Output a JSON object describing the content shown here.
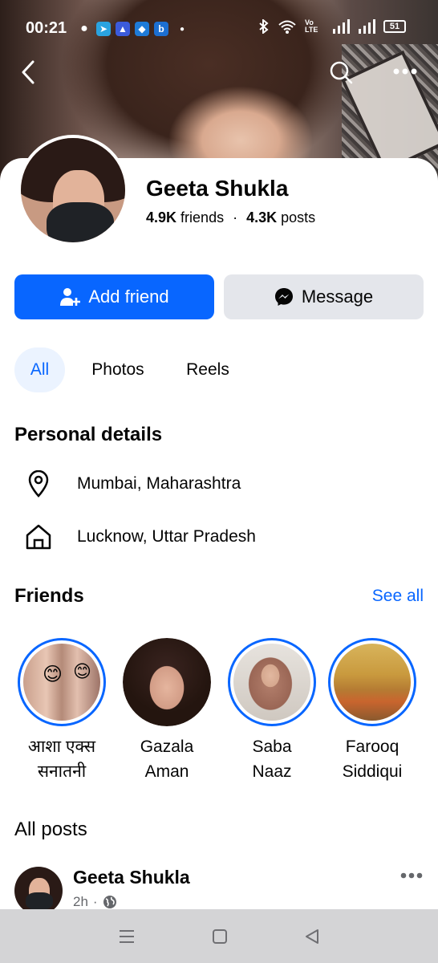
{
  "status_bar": {
    "time": "00:21",
    "notification_icons": [
      "chat-bubble-icon",
      "telegram-icon",
      "triangle-app-icon",
      "app-icon",
      "b-app-icon",
      "dot-icon"
    ],
    "network_label": "Vo LTE",
    "battery": "51"
  },
  "profile": {
    "name": "Geeta Shukla",
    "friends_count": "4.9K",
    "friends_label": "friends",
    "separator": "·",
    "posts_count": "4.3K",
    "posts_label": "posts"
  },
  "actions": {
    "add_friend": "Add friend",
    "message": "Message"
  },
  "tabs": {
    "all": "All",
    "photos": "Photos",
    "reels": "Reels",
    "active": "All"
  },
  "personal_details": {
    "title": "Personal details",
    "current_city": "Mumbai, Maharashtra",
    "hometown": "Lucknow, Uttar Pradesh"
  },
  "friends": {
    "title": "Friends",
    "see_all": "See all",
    "items": [
      {
        "line1": "आशा एक्स",
        "line2": "सनातनी"
      },
      {
        "line1": "Gazala",
        "line2": "Aman"
      },
      {
        "line1": "Saba",
        "line2": "Naaz"
      },
      {
        "line1": "Farooq",
        "line2": "Siddiqui"
      }
    ]
  },
  "posts": {
    "title": "All posts",
    "first": {
      "author": "Geeta Shukla",
      "time": "2h",
      "separator": "·",
      "audience_icon": "globe-icon"
    }
  },
  "colors": {
    "accent": "#0866ff",
    "secondary_button": "#e4e6eb",
    "tab_active_bg": "#ebf3ff",
    "text_primary": "#050505",
    "text_secondary": "#65676b",
    "nav_bar": "#d4d4d6"
  }
}
